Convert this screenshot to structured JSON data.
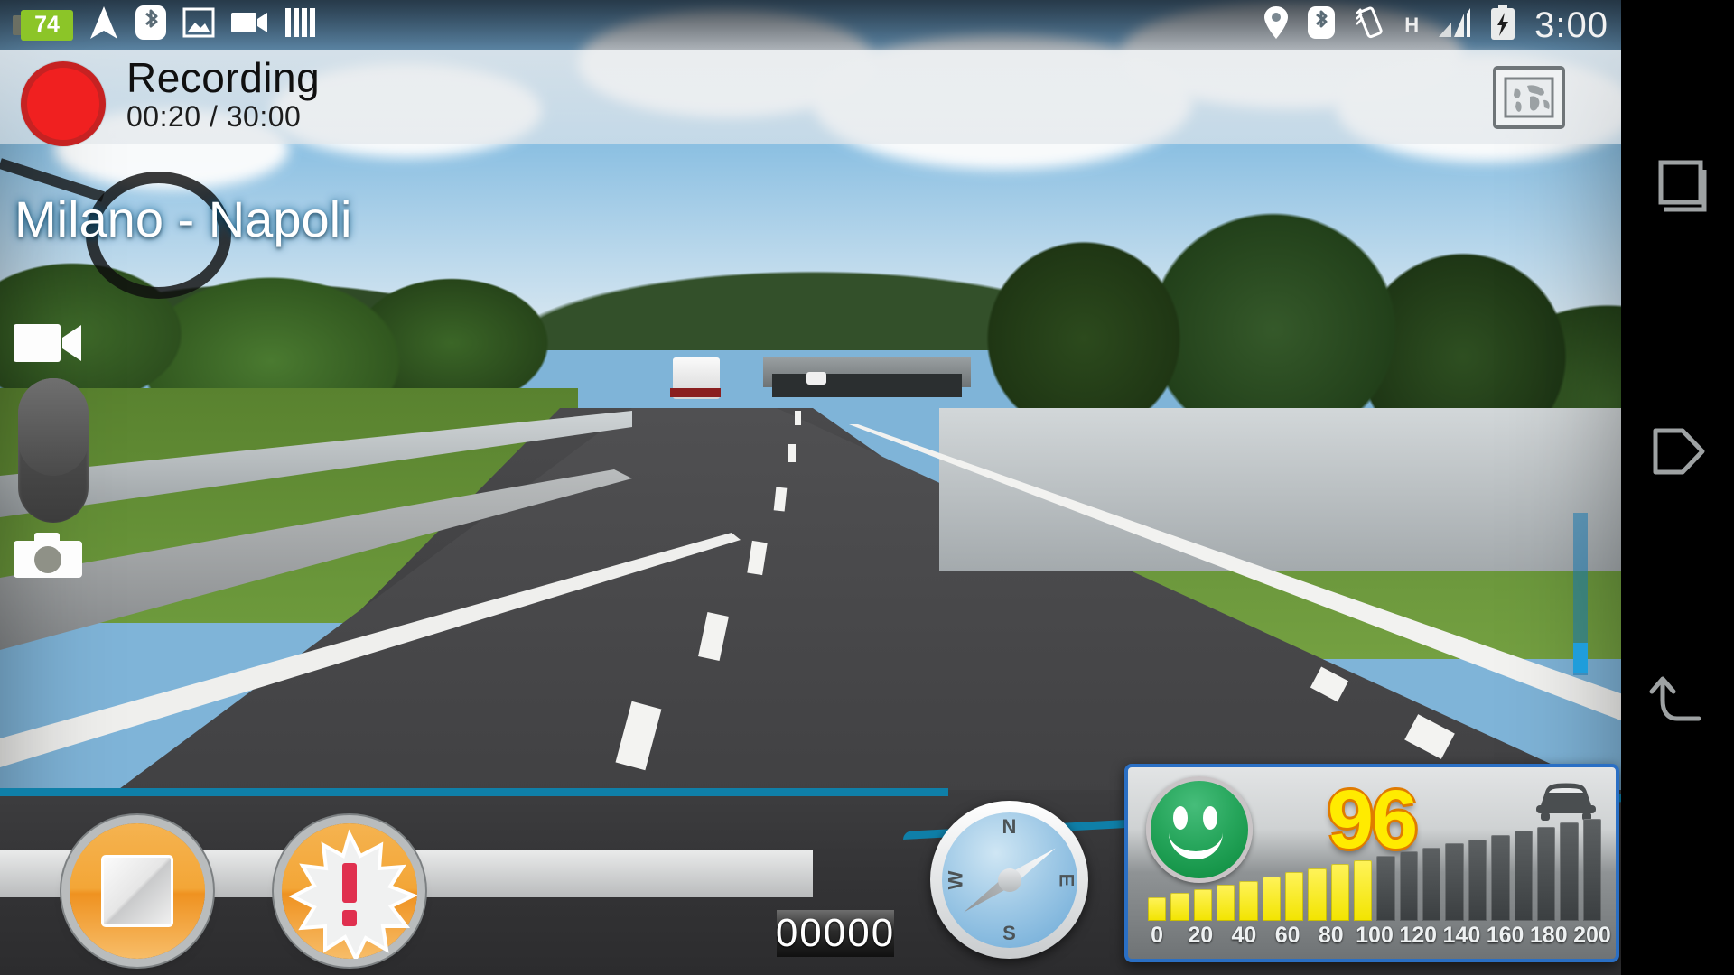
{
  "app": {
    "name": "dashcam-recorder",
    "trip_title": "Milano - Napoli"
  },
  "statusbar": {
    "battery_percent": "74",
    "clock": "3:00",
    "network_type": "H",
    "left_icons": [
      {
        "name": "battery-badge-icon",
        "label": "74"
      },
      {
        "name": "navigation-arrow-icon",
        "label": "navigation"
      },
      {
        "name": "bluetooth-icon",
        "label": "bluetooth"
      },
      {
        "name": "screenshot-image-icon",
        "label": "screenshot"
      },
      {
        "name": "video-camera-icon",
        "label": "recording"
      },
      {
        "name": "equalizer-bars-icon",
        "label": "equalizer"
      }
    ],
    "right_icons": [
      {
        "name": "location-pin-icon",
        "label": "gps"
      },
      {
        "name": "bluetooth-icon",
        "label": "bluetooth"
      },
      {
        "name": "vibrate-icon",
        "label": "vibrate"
      },
      {
        "name": "network-type-icon",
        "label": "H"
      },
      {
        "name": "signal-bars-icon",
        "label": "signal"
      },
      {
        "name": "battery-charging-icon",
        "label": "charging"
      }
    ]
  },
  "recording_bar": {
    "status": "Recording",
    "timer": "00:20 / 30:00",
    "record_indicator": "record-dot",
    "map_button_label": "world-map"
  },
  "left_controls": [
    {
      "name": "video-mode-icon",
      "label": "video"
    },
    {
      "name": "mode-slider",
      "label": "mode-toggle"
    },
    {
      "name": "photo-camera-icon",
      "label": "photo"
    }
  ],
  "zoom_slider": {
    "name": "zoom-track",
    "handle_label": "zoom-handle"
  },
  "hud": {
    "stop_button_label": "stop",
    "alert_button_label": "emergency-alert",
    "odometer": "00000",
    "compass": {
      "north": "N",
      "east": "E",
      "south": "S",
      "west": "W",
      "heading_deg": 55
    }
  },
  "speed_panel": {
    "value": "96",
    "unit_scale_max": 200,
    "driving_status_icon": "smiley-face-green",
    "vehicle_icon": "car-icon",
    "bars_total": 20,
    "bars_lit": 10,
    "scale_labels": [
      "0",
      "20",
      "40",
      "60",
      "80",
      "100",
      "120",
      "140",
      "160",
      "180",
      "200"
    ]
  },
  "navbar": {
    "buttons": [
      {
        "name": "recent-apps-button",
        "label": "recent"
      },
      {
        "name": "home-button",
        "label": "home"
      },
      {
        "name": "back-button",
        "label": "back"
      }
    ]
  },
  "colors": {
    "accent_teal": "#0f7fa8",
    "button_orange": "#f3a637",
    "speed_yellow": "#ffeb00",
    "battery_green": "#8cc528",
    "panel_border_blue": "#2a6fc4",
    "record_red": "#f02020"
  }
}
